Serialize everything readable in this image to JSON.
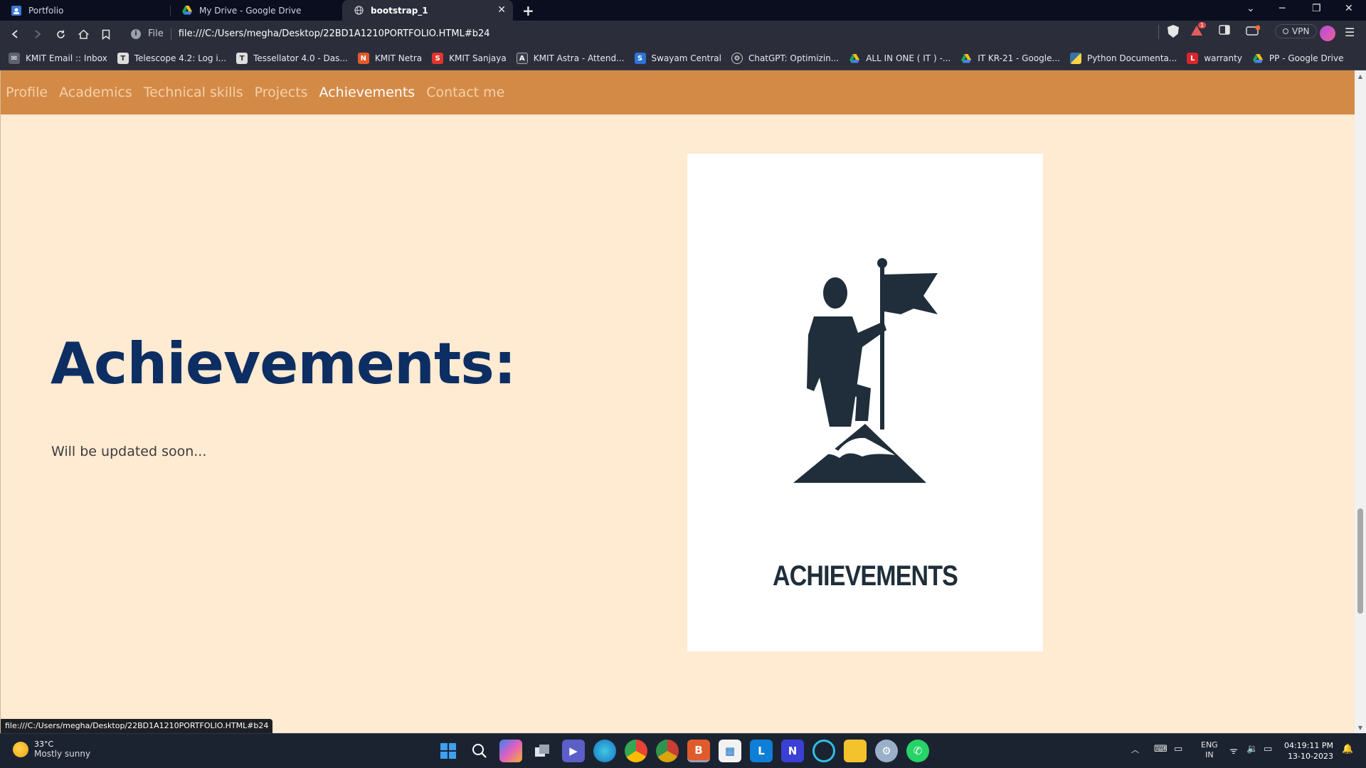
{
  "browser": {
    "tabs": [
      {
        "title": "Portfolio",
        "active": false
      },
      {
        "title": "My Drive - Google Drive",
        "active": false
      },
      {
        "title": "bootstrap_1",
        "active": true
      }
    ],
    "address": {
      "scheme": "File",
      "url": "file:///C:/Users/megha/Desktop/22BD1A1210PORTFOLIO.HTML#b24"
    },
    "vpn_label": "VPN",
    "notification_count": "1",
    "bookmarks": [
      {
        "label": "KMIT Email :: Inbox",
        "icon": "mail-icon"
      },
      {
        "label": "Telescope 4.2: Log i...",
        "icon": "telescope-icon"
      },
      {
        "label": "Tessellator 4.0 - Das...",
        "icon": "tessellator-icon"
      },
      {
        "label": "KMIT Netra",
        "icon": "netra-icon"
      },
      {
        "label": "KMIT Sanjaya",
        "icon": "sanjaya-icon"
      },
      {
        "label": "KMIT Astra - Attend...",
        "icon": "astra-icon"
      },
      {
        "label": "Swayam Central",
        "icon": "swayam-icon"
      },
      {
        "label": "ChatGPT: Optimizin...",
        "icon": "chatgpt-icon"
      },
      {
        "label": "ALL IN ONE ( IT ) -...",
        "icon": "drive-icon"
      },
      {
        "label": "IT KR-21 - Google...",
        "icon": "drive-icon"
      },
      {
        "label": "Python Documenta...",
        "icon": "python-icon"
      },
      {
        "label": "warranty",
        "icon": "warranty-icon"
      },
      {
        "label": "PP - Google Drive",
        "icon": "drive-icon"
      }
    ],
    "status_url": "file:///C:/Users/megha/Desktop/22BD1A1210PORTFOLIO.HTML#b24"
  },
  "site": {
    "nav": [
      {
        "label": "Profile",
        "active": false
      },
      {
        "label": "Academics",
        "active": false
      },
      {
        "label": "Technical skills",
        "active": false
      },
      {
        "label": "Projects",
        "active": false
      },
      {
        "label": "Achievements",
        "active": true
      },
      {
        "label": "Contact me",
        "active": false
      }
    ],
    "heading": "Achievements:",
    "body": "Will be updated soon...",
    "image_caption": "ACHIEVEMENTS",
    "colors": {
      "nav_bg": "#d48a47",
      "page_bg": "#ffead2",
      "heading": "#0d2e63",
      "figure": "#1f2e3a"
    }
  },
  "taskbar": {
    "weather": {
      "temp": "33°C",
      "condition": "Mostly sunny"
    },
    "tray": {
      "lang1": "ENG",
      "lang2": "IN"
    },
    "clock": {
      "time": "04:19:11 PM",
      "date": "13-10-2023"
    }
  }
}
